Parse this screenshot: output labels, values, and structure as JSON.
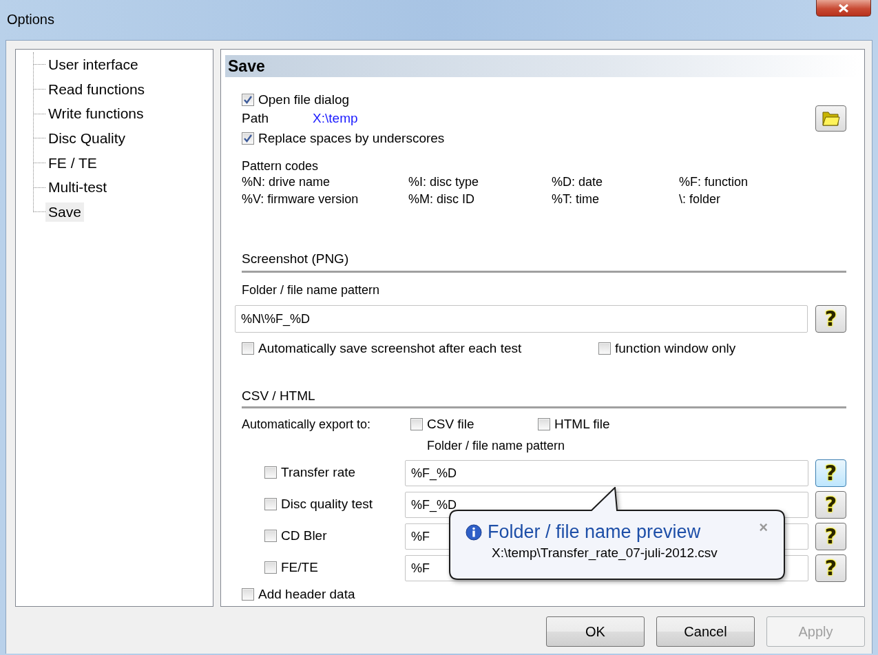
{
  "window": {
    "title": "Options"
  },
  "tree": {
    "items": [
      {
        "label": "User interface",
        "selected": false
      },
      {
        "label": "Read functions",
        "selected": false
      },
      {
        "label": "Write functions",
        "selected": false
      },
      {
        "label": "Disc Quality",
        "selected": false
      },
      {
        "label": "FE / TE",
        "selected": false
      },
      {
        "label": "Multi-test",
        "selected": false
      },
      {
        "label": "Save",
        "selected": true
      }
    ]
  },
  "panel": {
    "title": "Save",
    "open_file_dialog": {
      "label": "Open file dialog",
      "checked": true
    },
    "path": {
      "label": "Path",
      "value": "X:\\temp"
    },
    "replace_spaces": {
      "label": "Replace spaces by underscores",
      "checked": true
    },
    "pattern_codes": {
      "title": "Pattern codes",
      "codes": [
        "%N: drive name",
        "%I: disc type",
        "%D: date",
        "%F: function",
        "%V: firmware version",
        "%M: disc ID",
        "%T: time",
        "\\: folder"
      ]
    },
    "screenshot": {
      "heading": "Screenshot (PNG)",
      "pattern_label": "Folder / file name pattern",
      "pattern_value": "%N\\%F_%D",
      "help": {
        "label": "?",
        "hovered": false
      },
      "auto_save": {
        "label": "Automatically save screenshot after each test",
        "checked": false
      },
      "function_window_only": {
        "label": "function window only",
        "checked": false
      }
    },
    "csv_html": {
      "heading": "CSV / HTML",
      "export_label": "Automatically export to:",
      "csv_file": {
        "label": "CSV file",
        "checked": false
      },
      "html_file": {
        "label": "HTML file",
        "checked": false
      },
      "pattern_label": "Folder / file name pattern",
      "rows": [
        {
          "label": "Transfer rate",
          "checked": false,
          "value": "%F_%D",
          "help": {
            "label": "?",
            "hovered": true
          }
        },
        {
          "label": "Disc quality test",
          "checked": false,
          "value": "%F_%D",
          "help": {
            "label": "?",
            "hovered": false
          }
        },
        {
          "label": "CD Bler",
          "checked": false,
          "value": "%F",
          "help": {
            "label": "?",
            "hovered": false
          }
        },
        {
          "label": "FE/TE",
          "checked": false,
          "value": "%F",
          "help": {
            "label": "?",
            "hovered": false
          }
        }
      ],
      "add_header": {
        "label": "Add header data",
        "checked": false
      }
    },
    "tooltip": {
      "title": "Folder / file name preview",
      "text": "X:\\temp\\Transfer_rate_07-juli-2012.csv",
      "close": "×"
    }
  },
  "buttons": [
    {
      "label": "OK",
      "disabled": false
    },
    {
      "label": "Cancel",
      "disabled": false
    },
    {
      "label": "Apply",
      "disabled": true
    }
  ]
}
